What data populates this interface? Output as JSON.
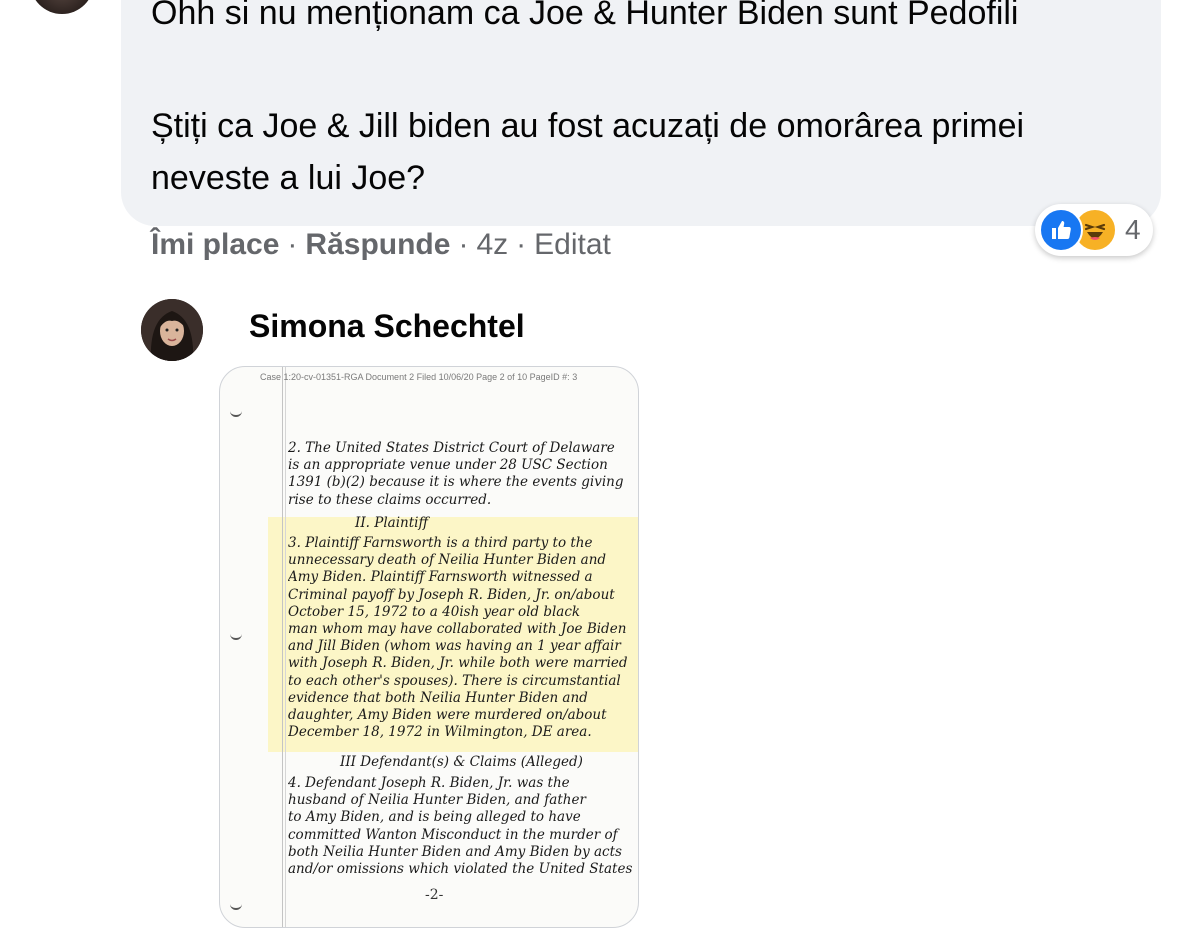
{
  "comment_top": {
    "line1": "Ohh si nu menționam ca Joe & Hunter Biden sunt Pedofili",
    "line2": "Știți ca Joe & Jill biden au fost acuzați de omorârea primei neveste a lui Joe?",
    "reactions": {
      "icons": [
        "like-icon",
        "haha-icon"
      ],
      "count": "4"
    },
    "actions": {
      "like": "Îmi place",
      "reply": "Răspunde",
      "time": "4z",
      "edited": "Editat"
    }
  },
  "comment_reply": {
    "author": "Simona Schechtel",
    "image": {
      "header": "Case 1:20-cv-01351-RGA   Document 2   Filed 10/06/20   Page 2 of 10 PageID #: 3",
      "para2": [
        "2. The United States District Court of Delaware",
        "is an appropriate venue under 28 USC Section",
        "1391 (b)(2) because it is where the events giving",
        "rise to these claims occurred."
      ],
      "section2": "II. Plaintiff",
      "para3": [
        "3. Plaintiff Farnsworth is a third party to the",
        "unnecessary death of Neilia Hunter Biden and",
        "Amy Biden. Plaintiff Farnsworth witnessed a",
        "Criminal payoff by Joseph R. Biden, Jr. on/about",
        "October 15, 1972 to a 40ish year old black",
        "man whom may have collaborated with Joe Biden",
        "and Jill Biden (whom was having an 1 year affair",
        "with Joseph R. Biden, Jr. while both were married",
        "to each other's spouses). There is circumstantial",
        "evidence that both Neilia Hunter Biden and",
        "daughter, Amy Biden were murdered on/about",
        "December 18, 1972 in Wilmington, DE area."
      ],
      "section3": "III Defendant(s) & Claims (Alleged)",
      "para4": [
        "4. Defendant Joseph R. Biden, Jr. was the",
        "husband of Neilia Hunter Biden, and father",
        "to Amy Biden, and is being alleged to have",
        "committed Wanton Misconduct in the murder of",
        "both Neilia Hunter Biden and Amy Biden by acts",
        "and/or omissions which violated the United States"
      ],
      "page_number": "-2-"
    }
  }
}
